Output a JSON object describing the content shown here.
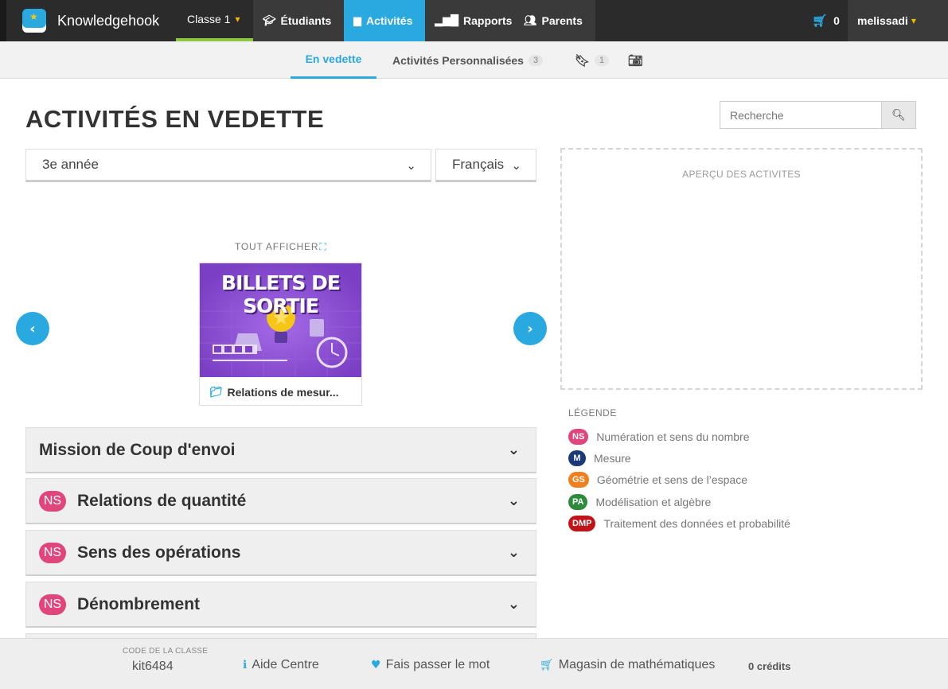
{
  "colors": {
    "accent": "#29a9df",
    "brand_bg": "#2b2b2b",
    "NS": "#e0457b",
    "M": "#1b3a7a",
    "GS": "#f07f1e",
    "PA": "#2e8b3e",
    "DMP": "#c0141a"
  },
  "brand": {
    "name": "Knowledgehook"
  },
  "topnav": {
    "classe": "Classe 1",
    "etudiants": "Étudiants",
    "activites": "Activités",
    "rapports": "Rapports",
    "parents": "Parents",
    "cart_count": "0",
    "user": "melissadi"
  },
  "subnav": {
    "vedette": "En vedette",
    "perso": "Activités Personnalisées",
    "perso_count": "3",
    "bookmark_count": "1"
  },
  "page": {
    "title": "ACTIVITÉS EN VEDETTE"
  },
  "search": {
    "placeholder": "Recherche"
  },
  "filters": {
    "grade": "3e année",
    "language": "Français"
  },
  "carousel": {
    "show_all": "TOUT AFFICHER",
    "card_image_title": "BILLETS DE SORTIE",
    "card_label": "Relations de mesur..."
  },
  "preview": {
    "label": "APERÇU DES ACTIVITES"
  },
  "legend": {
    "title": "LÉGENDE",
    "items": [
      {
        "code": "NS",
        "label": "Numération et sens du nombre"
      },
      {
        "code": "M",
        "label": "Mesure"
      },
      {
        "code": "GS",
        "label": "Géométrie et sens de l’espace"
      },
      {
        "code": "PA",
        "label": "Modélisation et algèbre"
      },
      {
        "code": "DMP",
        "label": "Traitement des données et probabilité"
      }
    ]
  },
  "sections": [
    {
      "label": "Mission de Coup d'envoi"
    },
    {
      "badge": "NS",
      "label": "Relations de quantité"
    },
    {
      "badge": "NS",
      "label": "Sens des opérations"
    },
    {
      "badge": "NS",
      "label": "Dénombrement"
    }
  ],
  "footer": {
    "code_label": "CODE DE LA CLASSE",
    "code_value": "kit6484",
    "aide": "Aide Centre",
    "share": "Fais passer le mot",
    "magasin": "Magasin de mathématiques",
    "credits": "0 crédits"
  }
}
